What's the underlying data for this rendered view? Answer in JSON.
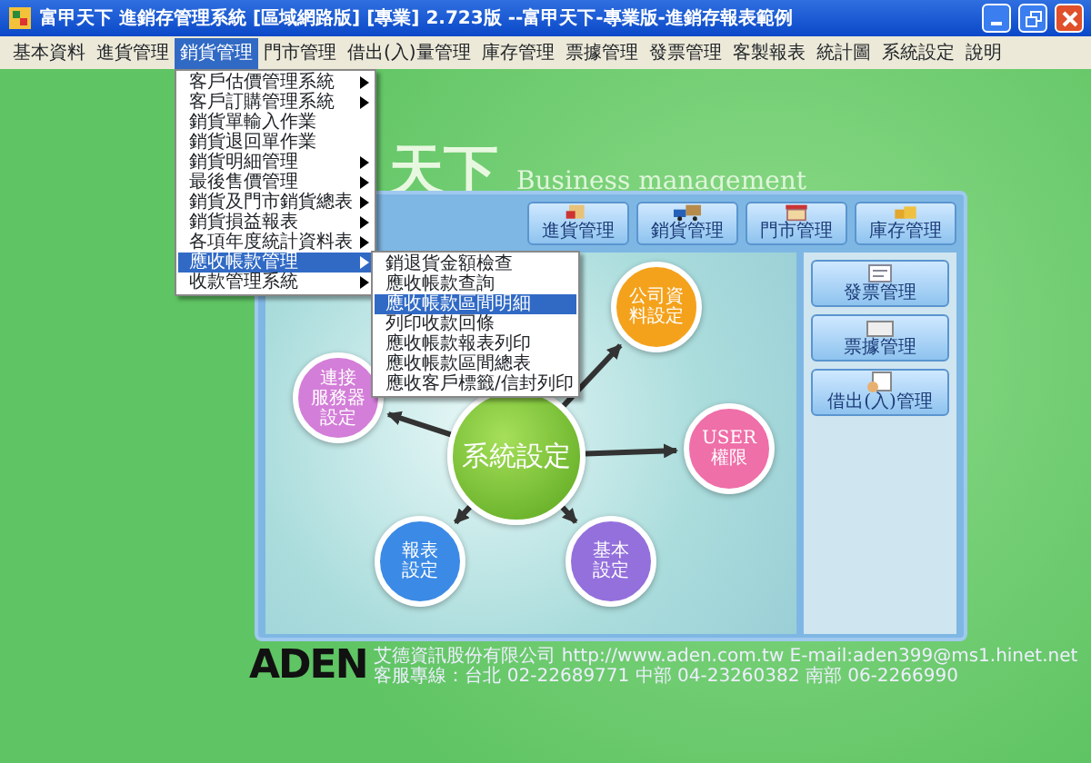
{
  "window": {
    "title": "富甲天下 進銷存管理系統 [區域網路版] [專業] 2.723版 --富甲天下-專業版-進銷存報表範例"
  },
  "menu_bar": [
    {
      "label": "基本資料",
      "selected": false
    },
    {
      "label": "進貨管理",
      "selected": false
    },
    {
      "label": "銷貨管理",
      "selected": true
    },
    {
      "label": "門市管理",
      "selected": false
    },
    {
      "label": "借出(入)量管理",
      "selected": false
    },
    {
      "label": "庫存管理",
      "selected": false
    },
    {
      "label": "票據管理",
      "selected": false
    },
    {
      "label": "發票管理",
      "selected": false
    },
    {
      "label": "客製報表",
      "selected": false
    },
    {
      "label": "統計圖",
      "selected": false
    },
    {
      "label": "系統設定",
      "selected": false
    },
    {
      "label": "說明",
      "selected": false
    }
  ],
  "dropdown_menu": [
    {
      "label": "客戶估價管理系統",
      "has_submenu": true,
      "selected": false
    },
    {
      "label": "客戶訂購管理系統",
      "has_submenu": true,
      "selected": false
    },
    {
      "label": "銷貨單輸入作業",
      "has_submenu": false,
      "selected": false
    },
    {
      "label": "銷貨退回單作業",
      "has_submenu": false,
      "selected": false
    },
    {
      "label": "銷貨明細管理",
      "has_submenu": true,
      "selected": false
    },
    {
      "label": "最後售價管理",
      "has_submenu": true,
      "selected": false
    },
    {
      "label": "銷貨及門市銷貨總表",
      "has_submenu": true,
      "selected": false
    },
    {
      "label": "銷貨損益報表",
      "has_submenu": true,
      "selected": false
    },
    {
      "label": "各項年度統計資料表",
      "has_submenu": true,
      "selected": false
    },
    {
      "label": "應收帳款管理",
      "has_submenu": true,
      "selected": true
    },
    {
      "label": "收款管理系統",
      "has_submenu": true,
      "selected": false
    }
  ],
  "submenu": [
    {
      "label": "銷退貨金額檢查",
      "selected": false
    },
    {
      "label": "應收帳款查詢",
      "selected": false
    },
    {
      "label": "應收帳款區間明細",
      "selected": true
    },
    {
      "label": "列印收款回條",
      "selected": false
    },
    {
      "label": "應收帳款報表列印",
      "selected": false
    },
    {
      "label": "應收帳款區間總表",
      "selected": false
    },
    {
      "label": "應收客戶標籤/信封列印",
      "selected": false
    }
  ],
  "banner": {
    "title": "天下",
    "subtitle": "Business management"
  },
  "toolbar": [
    {
      "label": "進貨管理"
    },
    {
      "label": "銷貨管理"
    },
    {
      "label": "門市管理"
    },
    {
      "label": "庫存管理"
    }
  ],
  "side_buttons": [
    {
      "label": "發票管理"
    },
    {
      "label": "票據管理"
    },
    {
      "label": "借出(入)管理"
    }
  ],
  "diagram": {
    "center": {
      "label": "系統設定"
    },
    "nodes": [
      {
        "lines": [
          "公司資",
          "料設定"
        ],
        "color": "#f4a21c"
      },
      {
        "lines": [
          "USER",
          "權限"
        ],
        "color": "#ef6fa8"
      },
      {
        "lines": [
          "基本",
          "設定"
        ],
        "color": "#9470dc"
      },
      {
        "lines": [
          "報表",
          "設定"
        ],
        "color": "#3b8ae6"
      },
      {
        "lines": [
          "連接",
          "服務器",
          "設定"
        ],
        "color": "#d37ed8"
      }
    ]
  },
  "footer": {
    "logo": "ADEN",
    "line_1": "艾德資訊股份有限公司   http://www.aden.com.tw   E-mail:aden399@ms1.hinet.net",
    "line_2": "客服專線：台北 02-22689771   中部 04-23260382   南部 06-2266990"
  }
}
